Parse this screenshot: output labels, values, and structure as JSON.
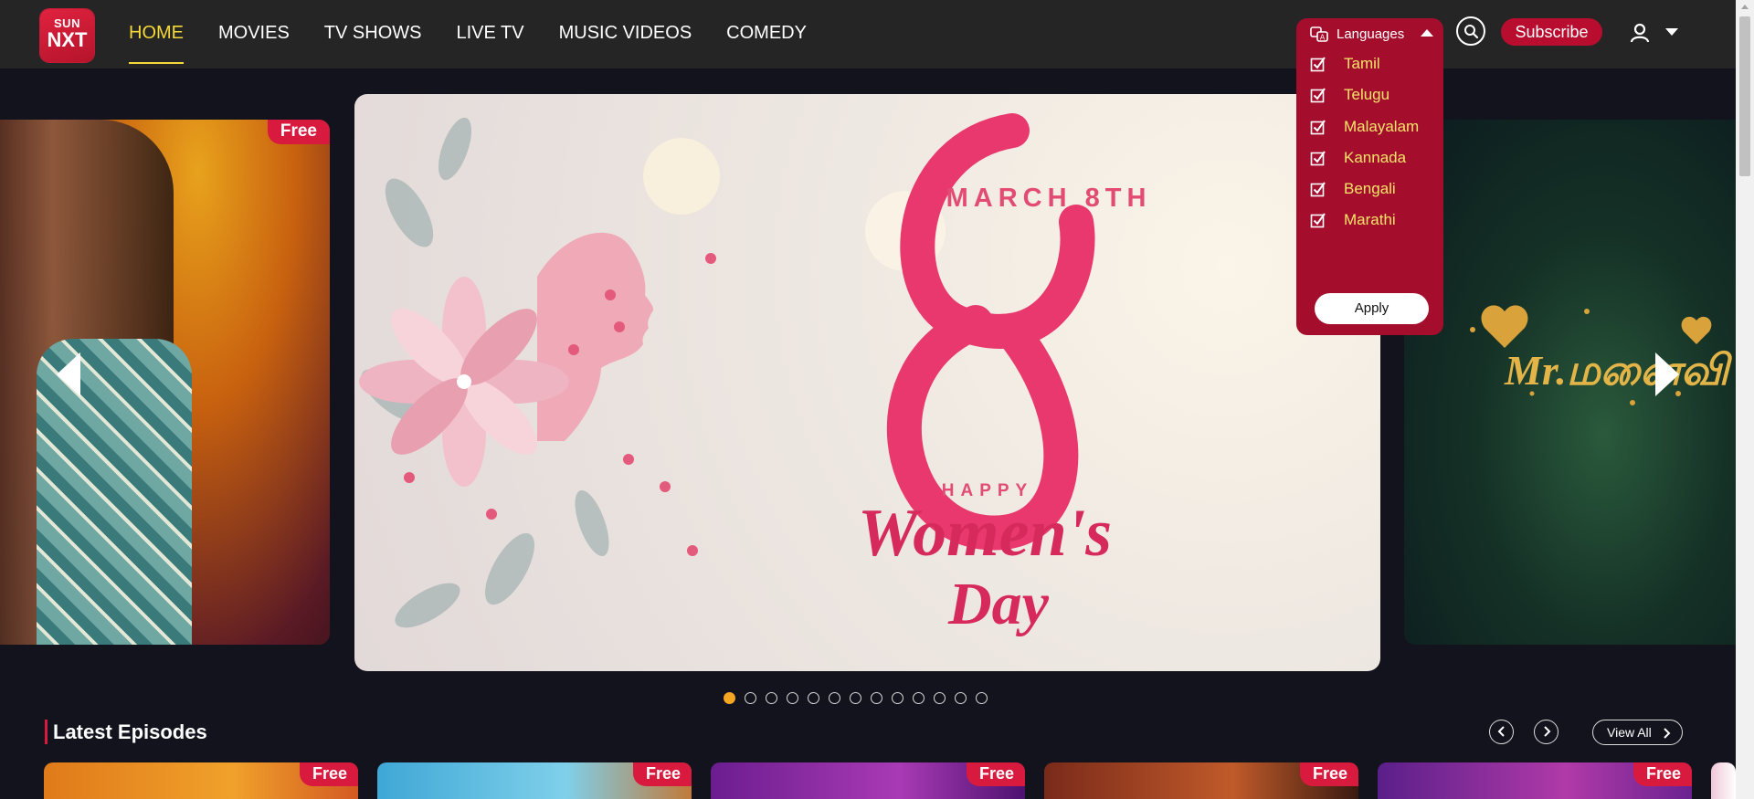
{
  "logo": {
    "line1": "SUN",
    "line2": "NXT"
  },
  "nav": [
    {
      "label": "HOME",
      "active": true
    },
    {
      "label": "MOVIES",
      "active": false
    },
    {
      "label": "TV SHOWS",
      "active": false
    },
    {
      "label": "LIVE TV",
      "active": false
    },
    {
      "label": "MUSIC VIDEOS",
      "active": false
    },
    {
      "label": "COMEDY",
      "active": false
    }
  ],
  "header": {
    "subscribe_label": "Subscribe"
  },
  "languages": {
    "label": "Languages",
    "options": [
      {
        "name": "Tamil",
        "checked": true
      },
      {
        "name": "Telugu",
        "checked": true
      },
      {
        "name": "Malayalam",
        "checked": true
      },
      {
        "name": "Kannada",
        "checked": true
      },
      {
        "name": "Bengali",
        "checked": true
      },
      {
        "name": "Marathi",
        "checked": true
      }
    ],
    "apply_label": "Apply"
  },
  "hero": {
    "left_badge": "Free",
    "center_text": {
      "date": "MARCH 8TH",
      "happy": "HAPPY",
      "womens": "Women's",
      "day": "Day"
    },
    "right_text": "Mr.மனைவி",
    "dot_count": 13,
    "active_dot": 0
  },
  "latest": {
    "title": "Latest Episodes",
    "view_all_label": "View All",
    "cards": [
      {
        "badge": "Free"
      },
      {
        "badge": "Free"
      },
      {
        "badge": "Free"
      },
      {
        "badge": "Free"
      },
      {
        "badge": "Free"
      }
    ]
  },
  "colors": {
    "accent_yellow": "#f5d83a",
    "brand_red": "#b80d2e",
    "dropdown_red": "#a50d2d",
    "free_badge": "#d91a3f",
    "pink": "#e8386d"
  }
}
